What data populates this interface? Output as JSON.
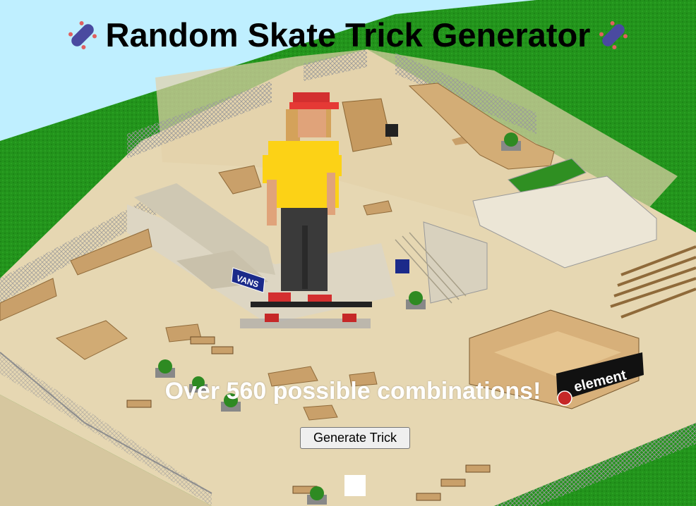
{
  "header": {
    "title": "Random Skate Trick Generator",
    "icon_left": "skateboard-icon",
    "icon_right": "skateboard-icon"
  },
  "main": {
    "subtitle": "Over 560 possible combinations!",
    "generate_button_label": "Generate Trick",
    "trick_result": ""
  },
  "scene": {
    "brand_logos": [
      "VANS",
      "element"
    ],
    "grass_color": "#1f8f1a",
    "concrete_color": "#e6d7b2",
    "sky_color": "#bfefff"
  }
}
